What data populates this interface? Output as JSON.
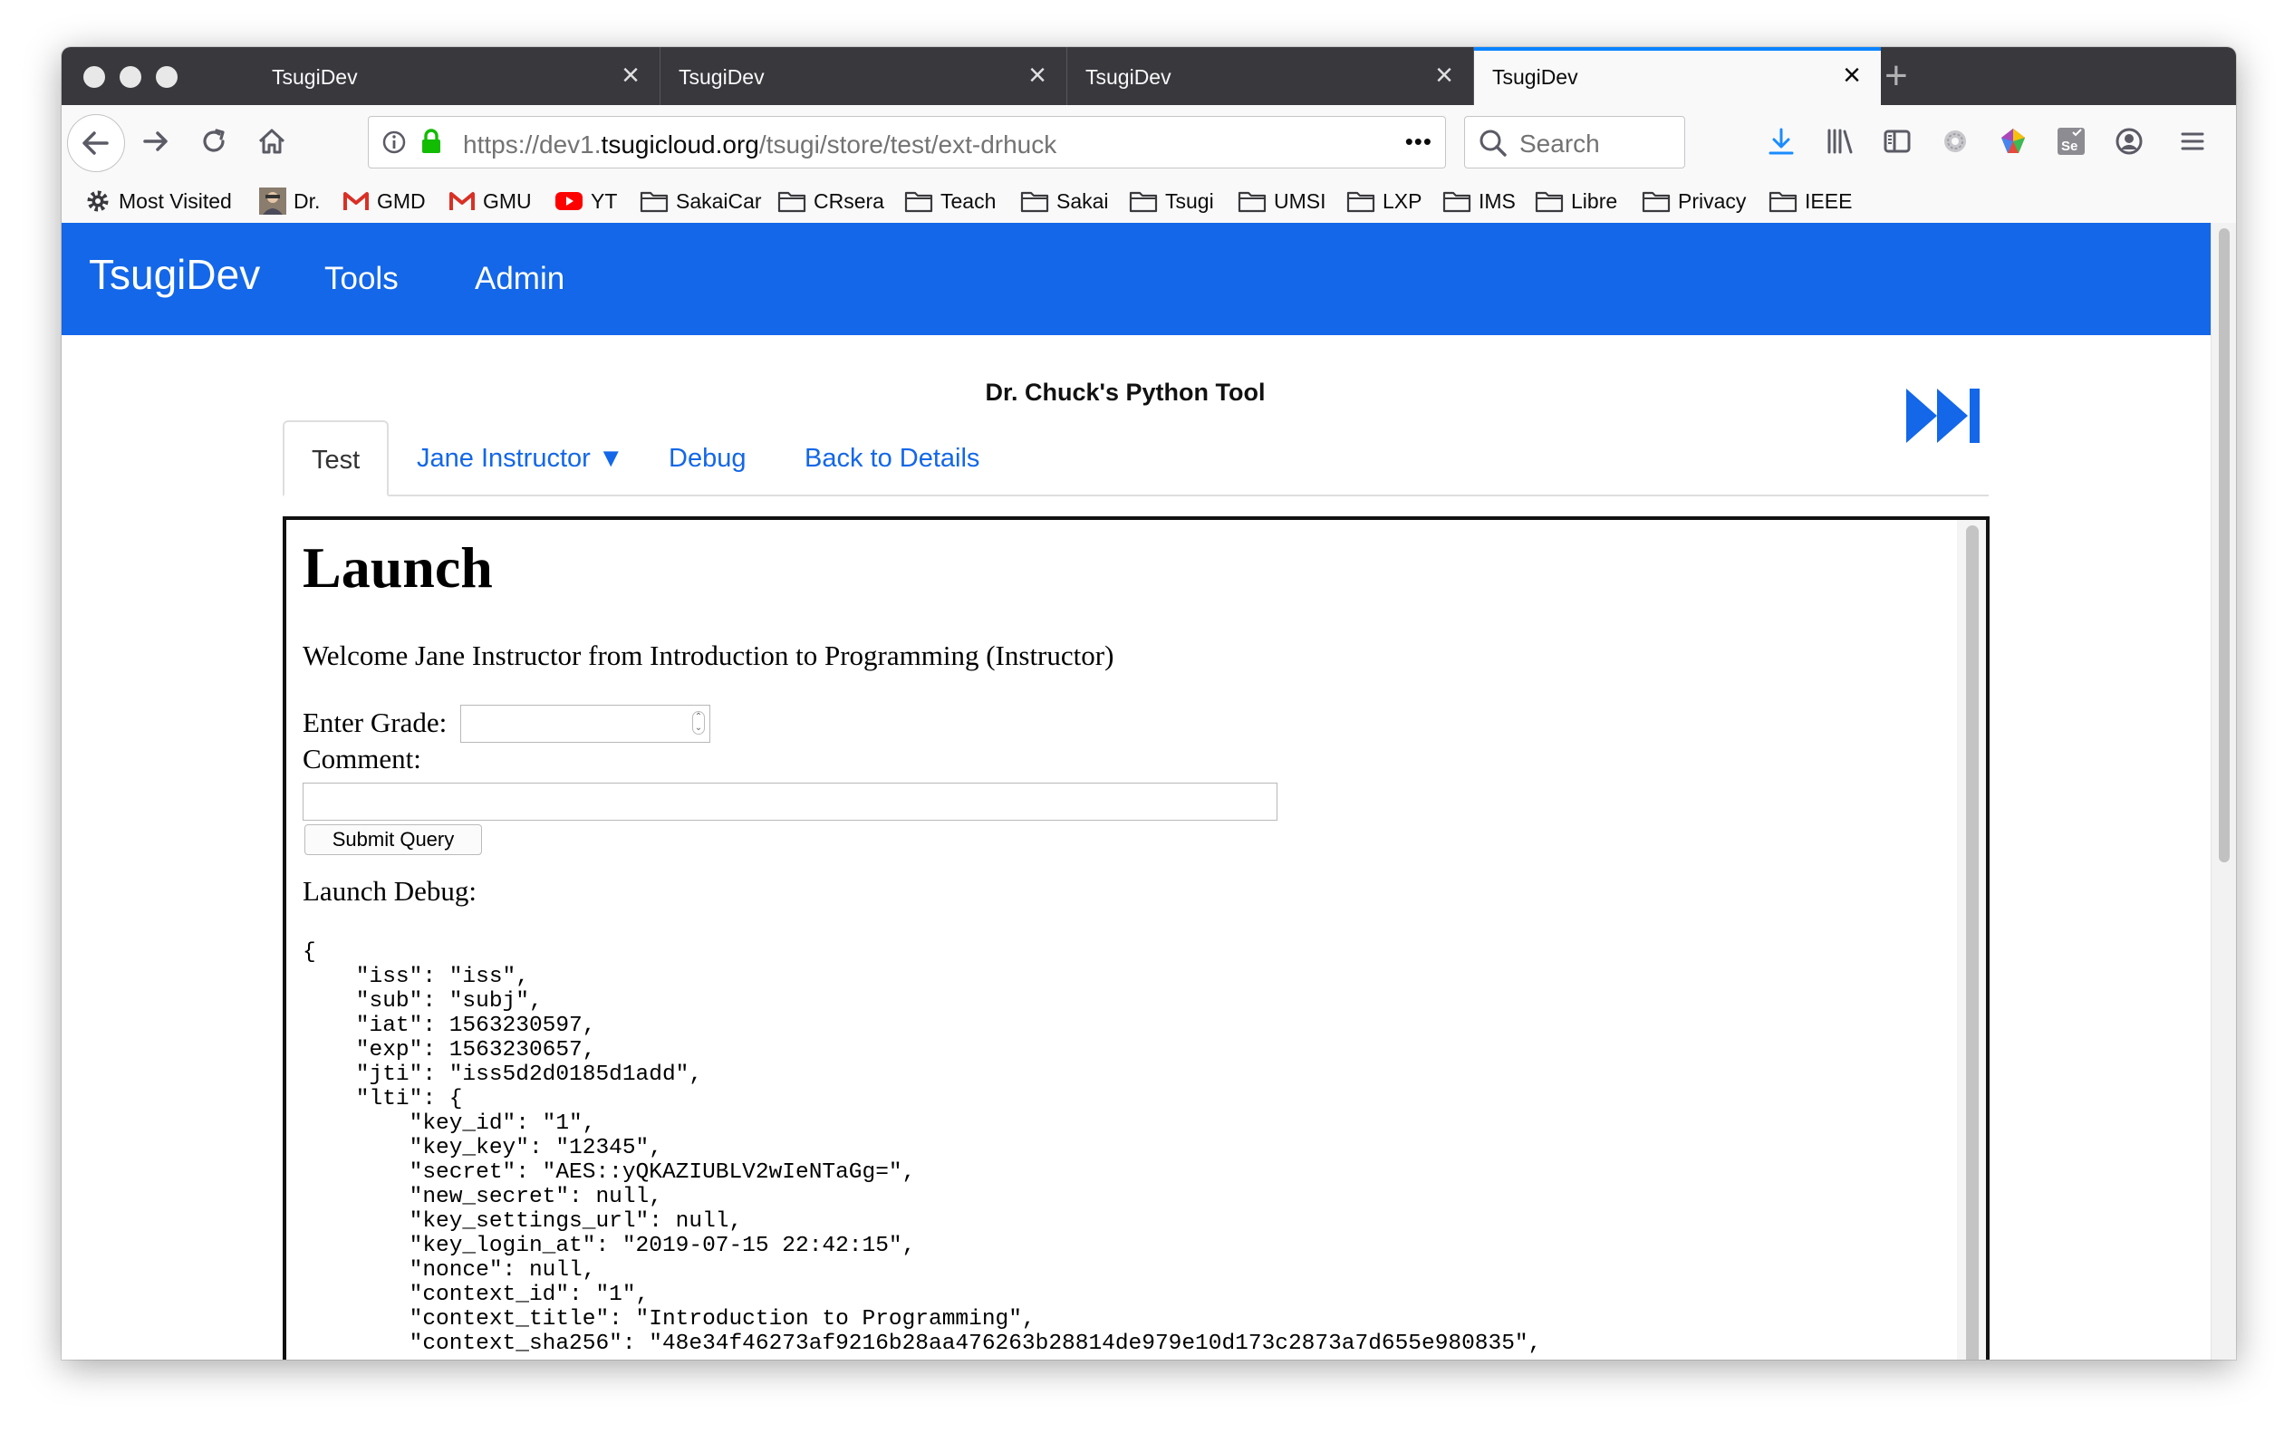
{
  "browser": {
    "tabs": [
      {
        "title": "TsugiDev",
        "active": false
      },
      {
        "title": "TsugiDev",
        "active": false
      },
      {
        "title": "TsugiDev",
        "active": false
      },
      {
        "title": "TsugiDev",
        "active": true
      }
    ],
    "close_glyph": "×",
    "new_tab_glyph": "+",
    "url_prefix": "https://dev1.",
    "url_domain": "tsugicloud.org",
    "url_path": "/tsugi/store/test/ext-drhuck",
    "page_actions_glyph": "•••",
    "search_placeholder": "Search",
    "bookmarks": [
      {
        "label": "Most Visited",
        "icon": "gear-icon"
      },
      {
        "label": "Dr.",
        "icon": "avatar-icon"
      },
      {
        "label": "GMD",
        "icon": "gmail-icon"
      },
      {
        "label": "GMU",
        "icon": "gmail-icon"
      },
      {
        "label": "YT",
        "icon": "youtube-icon"
      },
      {
        "label": "SakaiCar",
        "icon": "folder-icon"
      },
      {
        "label": "CRsera",
        "icon": "folder-icon"
      },
      {
        "label": "Teach",
        "icon": "folder-icon"
      },
      {
        "label": "Sakai",
        "icon": "folder-icon"
      },
      {
        "label": "Tsugi",
        "icon": "folder-icon"
      },
      {
        "label": "UMSI",
        "icon": "folder-icon"
      },
      {
        "label": "LXP",
        "icon": "folder-icon"
      },
      {
        "label": "IMS",
        "icon": "folder-icon"
      },
      {
        "label": "Libre",
        "icon": "folder-icon"
      },
      {
        "label": "Privacy",
        "icon": "folder-icon"
      },
      {
        "label": "IEEE",
        "icon": "folder-icon"
      }
    ]
  },
  "app": {
    "brand": "TsugiDev",
    "nav": [
      "Tools",
      "Admin"
    ],
    "accent_color": "#1367e8",
    "tool_title": "Dr. Chuck's Python Tool",
    "tabs": [
      "Test",
      "Jane Instructor ▼",
      "Debug",
      "Back to Details"
    ]
  },
  "launch": {
    "heading": "Launch",
    "welcome": "Welcome Jane Instructor from Introduction to Programming (Instructor)",
    "grade_label": "Enter Grade:",
    "grade_value": "",
    "comment_label": "Comment:",
    "comment_value": "",
    "submit_label": "Submit Query",
    "debug_label": "Launch Debug:",
    "debug_json": "{\n    \"iss\": \"iss\",\n    \"sub\": \"subj\",\n    \"iat\": 1563230597,\n    \"exp\": 1563230657,\n    \"jti\": \"iss5d2d0185d1add\",\n    \"lti\": {\n        \"key_id\": \"1\",\n        \"key_key\": \"12345\",\n        \"secret\": \"AES::yQKAZIUBLV2wIeNTaGg=\",\n        \"new_secret\": null,\n        \"key_settings_url\": null,\n        \"key_login_at\": \"2019-07-15 22:42:15\",\n        \"nonce\": null,\n        \"context_id\": \"1\",\n        \"context_title\": \"Introduction to Programming\",\n        \"context_sha256\": \"48e34f46273af9216b28aa476263b28814de979e10d173c2873a7d655e980835\","
  }
}
